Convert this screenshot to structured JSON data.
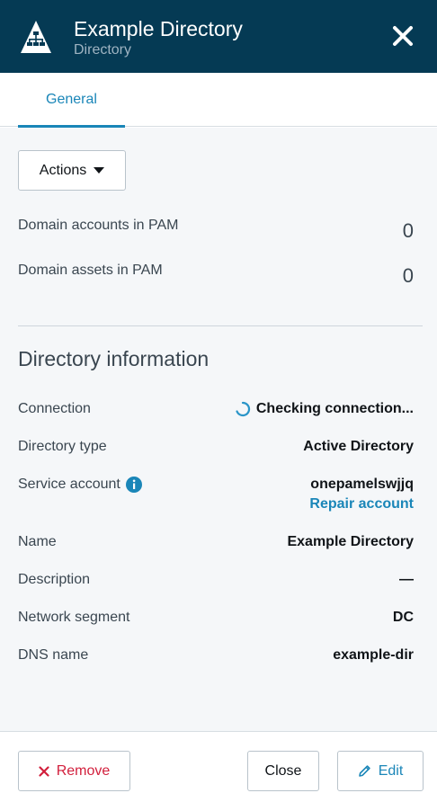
{
  "header": {
    "title": "Example Directory",
    "subtitle": "Directory",
    "logo_icon": "directory-tree-icon",
    "close_icon": "close-icon",
    "bg_color": "#053a54"
  },
  "tabs": [
    {
      "label": "General",
      "active": true
    }
  ],
  "actions": {
    "label": "Actions",
    "icon": "caret-down-icon"
  },
  "stats": [
    {
      "label": "Domain accounts in PAM",
      "value": "0"
    },
    {
      "label": "Domain assets in PAM",
      "value": "0"
    }
  ],
  "directory_info": {
    "title": "Directory information",
    "connection": {
      "label": "Connection",
      "value": "Checking connection..."
    },
    "directory_type": {
      "label": "Directory type",
      "value": "Active Directory"
    },
    "service_account": {
      "label": "Service account",
      "value": "onepamelswjjq",
      "link": "Repair account",
      "icon": "info-icon"
    },
    "name": {
      "label": "Name",
      "value": "Example Directory"
    },
    "description": {
      "label": "Description",
      "value": "—"
    },
    "network_segment": {
      "label": "Network segment",
      "value": "DC"
    },
    "dns_name": {
      "label": "DNS name",
      "value": "example-dir"
    }
  },
  "footer": {
    "remove_label": "Remove",
    "close_label": "Close",
    "edit_label": "Edit"
  },
  "colors": {
    "accent": "#1a86b8",
    "danger": "#d21f3c",
    "header_bg": "#053a54"
  }
}
